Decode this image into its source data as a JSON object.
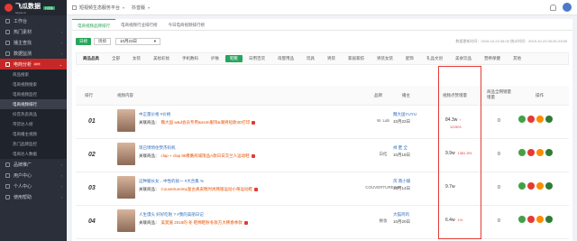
{
  "brand": {
    "name": "飞瓜数据",
    "sub": "feigua.cn",
    "badge": "抖音版"
  },
  "sidebar": {
    "items": [
      {
        "label": "工作台"
      },
      {
        "label": "热门素材"
      },
      {
        "label": "播主查找"
      },
      {
        "label": "数据监测"
      },
      {
        "label": "电商分析",
        "hot": "HOT"
      }
    ],
    "sub_items": [
      {
        "label": "商品搜索"
      },
      {
        "label": "电商视频搜索"
      },
      {
        "label": "电商视频监控"
      },
      {
        "label": "电商视频排行"
      },
      {
        "label": "抖音热卖商品"
      },
      {
        "label": "带货达人榜"
      },
      {
        "label": "电商播主视频"
      },
      {
        "label": "热门品牌监控"
      },
      {
        "label": "电商达人数据"
      }
    ],
    "bottom_items": [
      {
        "label": "品牌推广"
      },
      {
        "label": "用户中心"
      },
      {
        "label": "个人中心"
      },
      {
        "label": "使用帮助"
      }
    ]
  },
  "header": {
    "btn1": "短视频生态服务平台",
    "btn2": "抖音版"
  },
  "tabs": [
    {
      "label": "电商视频品牌排行"
    },
    {
      "label": "电商视频行业排行榜"
    },
    {
      "label": "今日电商视频排行榜"
    }
  ],
  "toolbar": {
    "day": "日榜",
    "week": "周榜",
    "date": "10月23日",
    "update": "数据更新时间：2019-10-24 06:00  统计时间：2019-10-23 00:00-23:59"
  },
  "categories": [
    "商品品类",
    "全部",
    "女装",
    "美妆彩妆",
    "手机数码",
    "护肤",
    "鞋靴",
    "日用百货",
    "母婴用品",
    "玩具",
    "男装",
    "家居家纺",
    "男装女装",
    "配饰",
    "礼品文创",
    "美食饮品",
    "营养保健",
    "其他"
  ],
  "selected_category": "鞋靴",
  "table": {
    "headers": {
      "rank": "排行",
      "content": "视频内容",
      "brand": "品牌",
      "blogger": "播主",
      "likes": "视频点赞增量",
      "total": "商品全网销量增量",
      "ops": "操作"
    },
    "goods_label": "关联商品：",
    "rows": [
      {
        "rank": "01",
        "title": "中正量价格 #价格",
        "goods": "魏大国 w&d会员专用&ss3n服饰&潮男短款3D打印",
        "brand": "W. Lab",
        "blogger": "魏大国YUYU",
        "date": "10月22日",
        "likes": "84.3w",
        "arrow": "↑",
        "below": "1226%",
        "total": "0"
      },
      {
        "rank": "02",
        "title": "现已悄悄住赞杰码机",
        "goods": "clap + clap 8k模番商城限品A款日日交兰人运动鞋",
        "brand": "白桔",
        "blogger": "禄 匿 全",
        "date": "10月18日",
        "likes": "9.9w",
        "pct": "1381.5%",
        "total": "0"
      },
      {
        "rank": "03",
        "title": "这种腿长女…中性的就一 #大合集 %",
        "goods": "Couvertureimp复古真皮靴时尚韩版运动小蒂运动鞋",
        "brand": "COUVERTUREIMP",
        "blogger": "芮 南小铺",
        "date": "10月14日",
        "likes": "9.7w",
        "total": "0"
      },
      {
        "rank": "04",
        "title": "人生馒头 好好吃啦 ? #我的美丽日记",
        "goods": "美莫施 2019的 冬 鞋棉鞋秋冬款方大韩春季款",
        "brand": "换妆",
        "blogger": "大猫鸡鸡",
        "date": "10月20日",
        "likes": "6.4w",
        "pct": "1%",
        "total": "0"
      }
    ]
  }
}
